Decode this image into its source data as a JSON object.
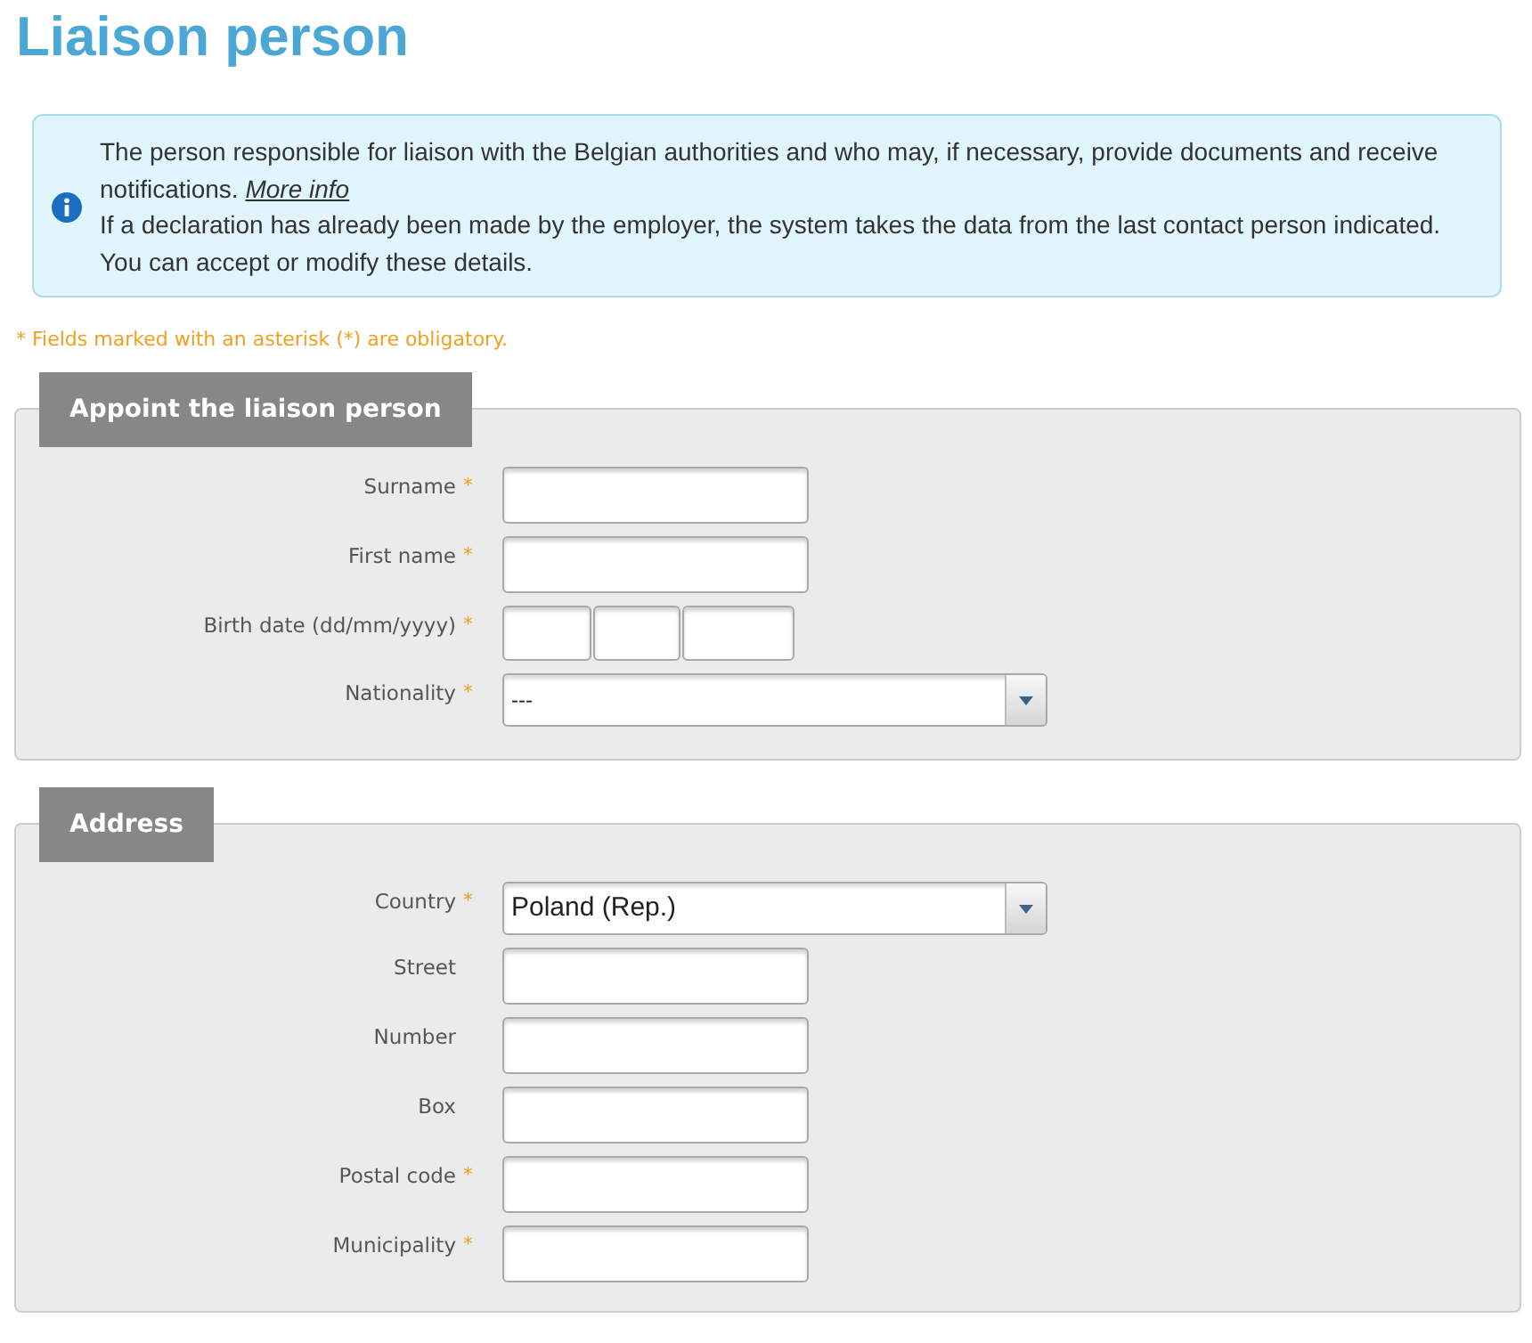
{
  "title": "Liaison person",
  "info": {
    "text": "The person responsible for liaison with the Belgian authorities and who may, if necessary, provide documents and receive notifications.",
    "link": "More info",
    "lines": [
      "If a declaration has already been made by the employer, the system takes the data from the last contact person indicated.",
      "You can accept or modify these details."
    ]
  },
  "required_note": "* Fields marked with an asterisk (*) are obligatory.",
  "required_marker": "*",
  "sections": [
    {
      "title": "Appoint the liaison person",
      "fields": [
        {
          "label": "Surname",
          "kind": "text",
          "required": true
        },
        {
          "label": "First name",
          "kind": "text",
          "required": true
        },
        {
          "label": "Birth date (dd/mm/yyyy)",
          "kind": "date",
          "required": true
        },
        {
          "label": "Nationality",
          "kind": "select",
          "required": true,
          "value": "---"
        }
      ]
    },
    {
      "title": "Address",
      "fields": [
        {
          "label": "Country",
          "kind": "select",
          "required": true,
          "value": "Poland (Rep.)"
        },
        {
          "label": "Street",
          "kind": "text",
          "required": false
        },
        {
          "label": "Number",
          "kind": "text",
          "required": false
        },
        {
          "label": "Box",
          "kind": "text",
          "required": false
        },
        {
          "label": "Postal code",
          "kind": "text",
          "required": true
        },
        {
          "label": "Municipality",
          "kind": "text",
          "required": true
        }
      ]
    }
  ]
}
